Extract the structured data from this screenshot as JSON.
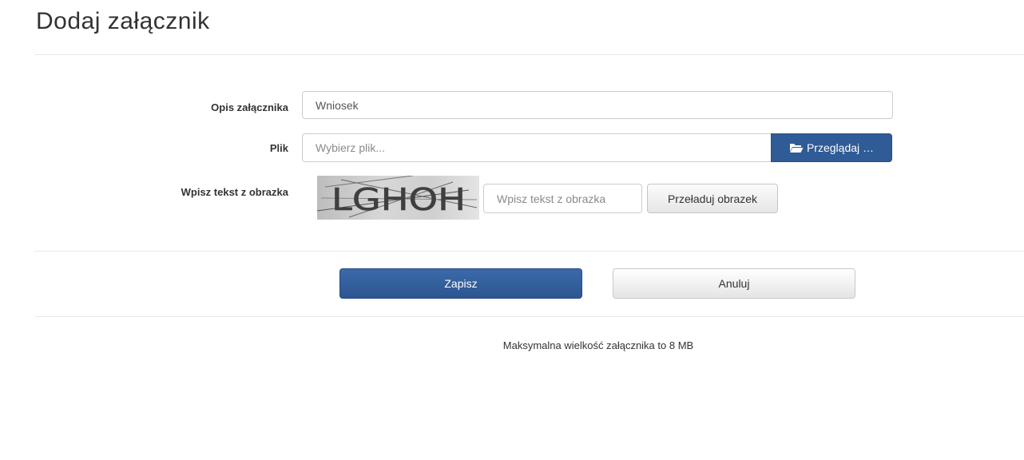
{
  "page": {
    "title": "Dodaj załącznik"
  },
  "form": {
    "description": {
      "label": "Opis załącznika",
      "value": "Wniosek"
    },
    "file": {
      "label": "Plik",
      "placeholder": "Wybierz plik...",
      "browse_label": "Przeglądaj …",
      "browse_icon": "folder-open-icon"
    },
    "captcha": {
      "label": "Wpisz tekst z obrazka",
      "image_text": "LGHOH",
      "input_placeholder": "Wpisz tekst z obrazka",
      "reload_label": "Przeładuj obrazek"
    }
  },
  "actions": {
    "save_label": "Zapisz",
    "cancel_label": "Anuluj"
  },
  "footer": {
    "max_size_note": "Maksymalna wielkość załącznika to 8 MB"
  },
  "colors": {
    "primary": "#2f5b96",
    "text": "#333333",
    "border": "#cccccc"
  }
}
